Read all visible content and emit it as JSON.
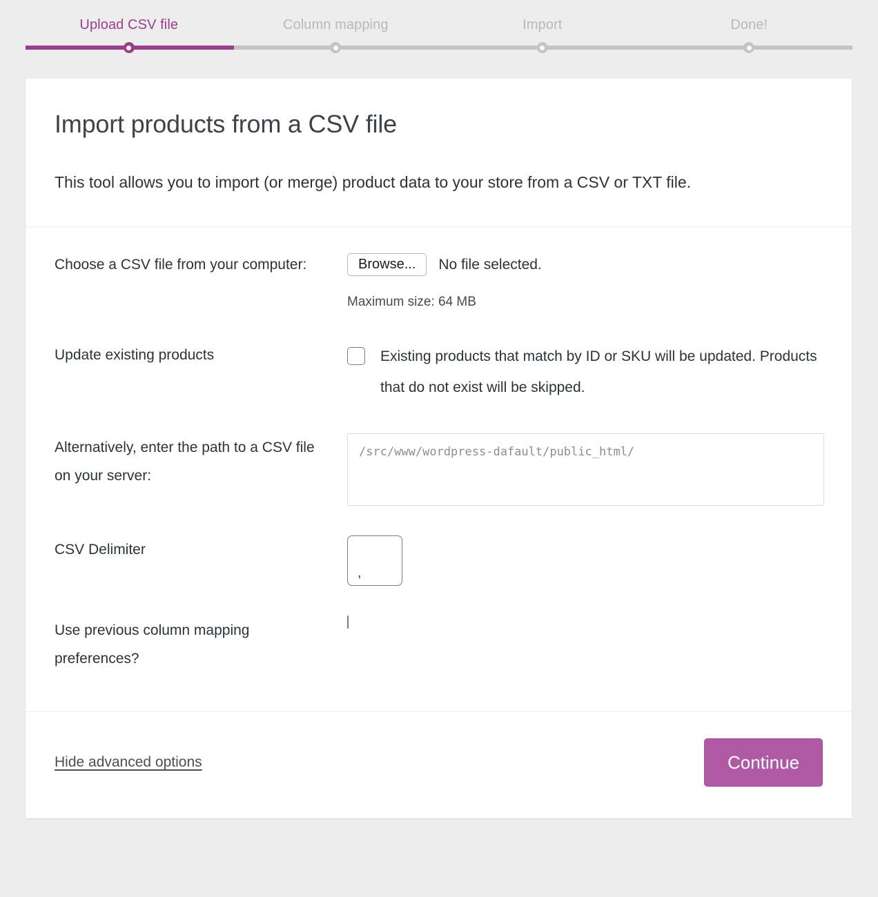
{
  "stepper": {
    "steps": [
      {
        "label": "Upload CSV file",
        "state": "active"
      },
      {
        "label": "Column mapping",
        "state": "upcoming"
      },
      {
        "label": "Import",
        "state": "upcoming"
      },
      {
        "label": "Done!",
        "state": "upcoming"
      }
    ],
    "active_color": "#9b3d8b",
    "inactive_color": "#c4c4c4",
    "progress_percent": 25
  },
  "card": {
    "title": "Import products from a CSV file",
    "description": "This tool allows you to import (or merge) product data to your store from a CSV or TXT file."
  },
  "form": {
    "file_row": {
      "label": "Choose a CSV file from your computer:",
      "browse_button": "Browse...",
      "file_status": "No file selected.",
      "max_size": "Maximum size: 64 MB"
    },
    "update_row": {
      "label": "Update existing products",
      "checkbox_checked": false,
      "description": "Existing products that match by ID or SKU will be updated. Products that do not exist will be skipped."
    },
    "path_row": {
      "label": "Alternatively, enter the path to a CSV file on your server:",
      "value": "",
      "placeholder": "/src/www/wordpress-dafault/public_html/"
    },
    "delimiter_row": {
      "label": "CSV Delimiter",
      "value": ","
    },
    "previous_mapping_row": {
      "label": "Use previous column mapping preferences?",
      "checkbox_checked": false
    }
  },
  "footer": {
    "advanced_link": "Hide advanced options",
    "continue_button": "Continue",
    "button_color": "#b05aa6"
  }
}
